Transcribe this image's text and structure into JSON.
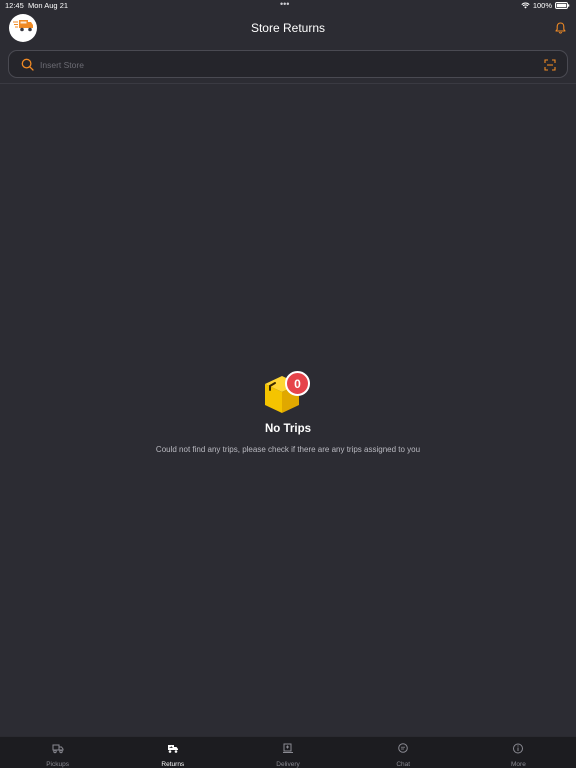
{
  "status_bar": {
    "time": "12:45",
    "date": "Mon Aug 21",
    "dots": "•••",
    "battery": "100%"
  },
  "header": {
    "title": "Store Returns",
    "logo_icon": "delivery-truck-logo",
    "notification_icon": "bell-icon"
  },
  "search": {
    "placeholder": "Insert Store",
    "value": "",
    "left_icon": "search-icon",
    "right_icon": "scan-icon"
  },
  "empty_state": {
    "badge_count": "0",
    "title": "No Trips",
    "message": "Could not find any trips, please check if there are any trips assigned to you",
    "illustration": "box-icon"
  },
  "tabs": [
    {
      "label": "Pickups",
      "icon": "pickup-truck-icon",
      "active": false
    },
    {
      "label": "Returns",
      "icon": "returns-truck-icon",
      "active": true
    },
    {
      "label": "Delivery",
      "icon": "delivery-icon",
      "active": false
    },
    {
      "label": "Chat",
      "icon": "chat-icon",
      "active": false
    },
    {
      "label": "More",
      "icon": "info-icon",
      "active": false
    }
  ],
  "colors": {
    "background": "#2c2c33",
    "accent": "#f08a24",
    "badge": "#e6434a",
    "box": "#f5c400",
    "tab_bar": "#1c1c20"
  }
}
